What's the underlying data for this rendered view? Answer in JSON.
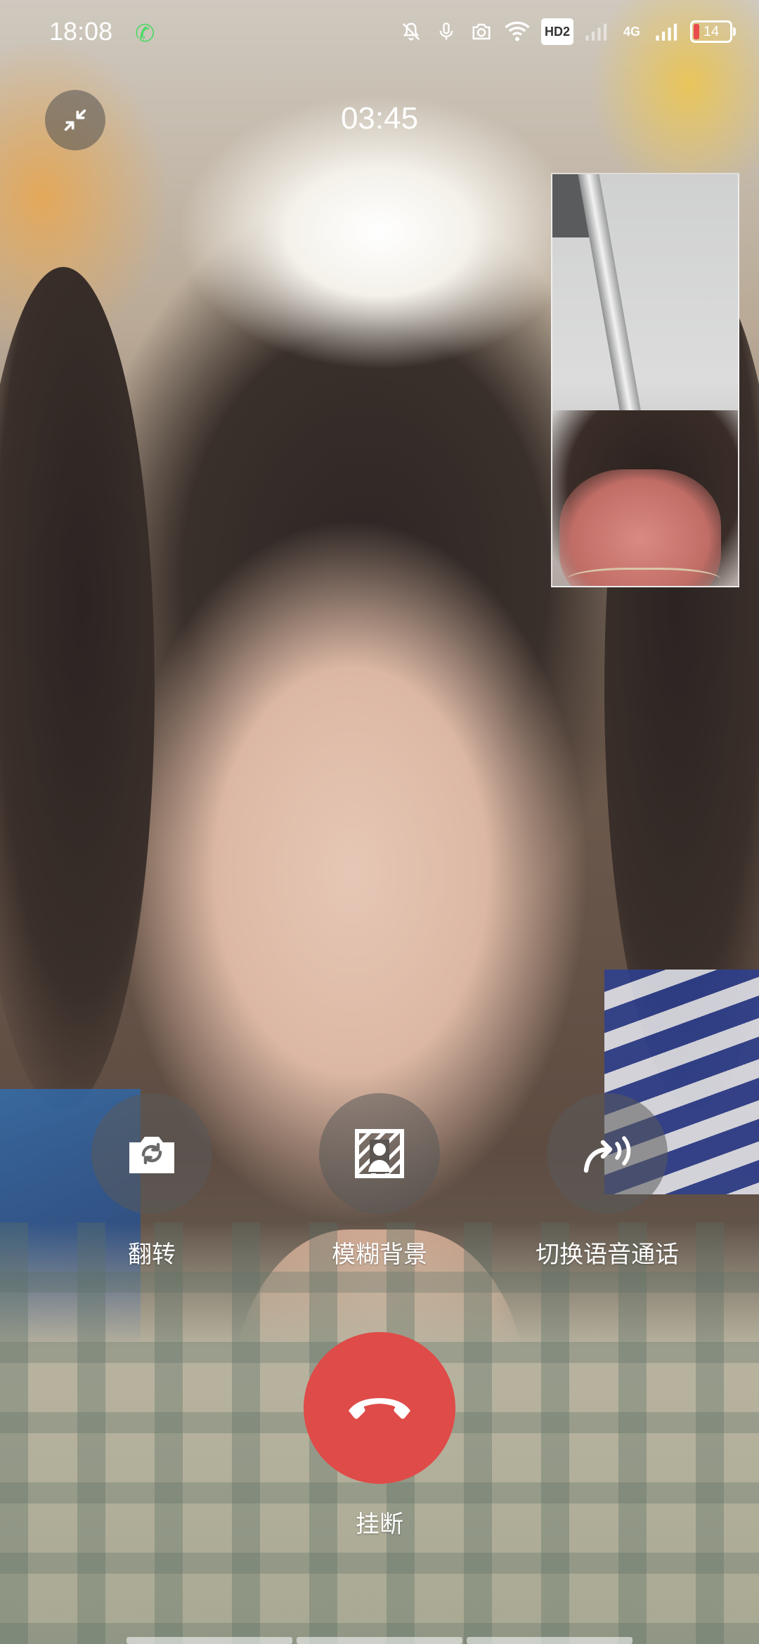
{
  "status_bar": {
    "time": "18:08",
    "battery_level": "14",
    "network": "4G",
    "hd_label": "HD2",
    "icons": [
      "phone-call-icon",
      "mute-bell-icon",
      "microphone-icon",
      "camera-icon",
      "wifi-icon",
      "hd-icon",
      "signal-icon",
      "battery-icon"
    ],
    "call_icon_color": "#4cd964",
    "battery_low_color": "#e84c4c"
  },
  "call": {
    "duration": "03:45"
  },
  "controls": {
    "flip_label": "翻转",
    "blur_label": "模糊背景",
    "switch_voice_label": "切换语音通话",
    "hangup_label": "挂断",
    "hangup_color": "#df4b48"
  }
}
